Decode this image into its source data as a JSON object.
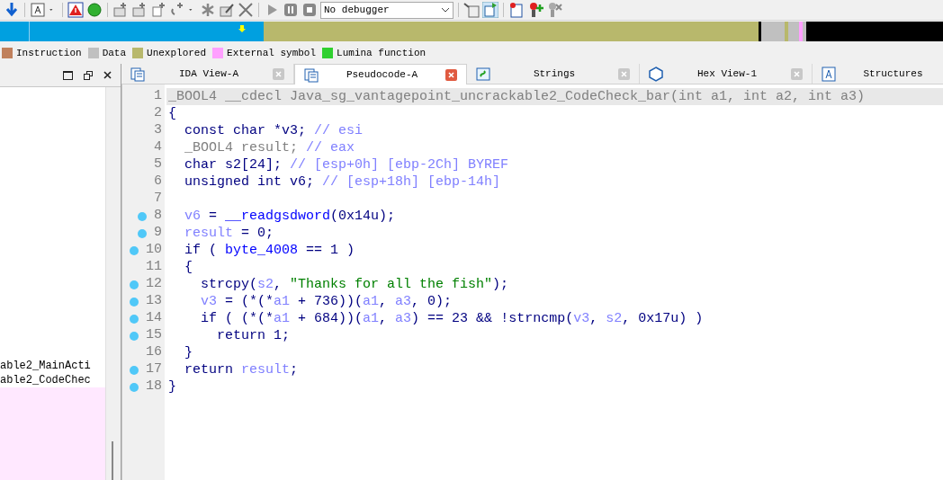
{
  "toolbar": {
    "debugger_select": {
      "value": "No debugger"
    }
  },
  "legend": [
    {
      "label": "Instruction",
      "color": "#c0805c"
    },
    {
      "label": "Data",
      "color": "#c0c0c0"
    },
    {
      "label": "Unexplored",
      "color": "#b8b86c"
    },
    {
      "label": "External symbol",
      "color": "#ffa0ff"
    },
    {
      "label": "Lumina function",
      "color": "#30d030"
    }
  ],
  "left_panel": {
    "items": [
      {
        "label": "able2_MainActi"
      },
      {
        "label": "able2_CodeChec"
      }
    ]
  },
  "tabs": [
    {
      "label": "IDA View-A",
      "selected": false,
      "closable": true
    },
    {
      "label": "Pseudocode-A",
      "selected": true,
      "closable": true
    },
    {
      "label": "Strings",
      "selected": false,
      "closable": true
    },
    {
      "label": "Hex View-1",
      "selected": false,
      "closable": true
    },
    {
      "label": "Structures",
      "selected": false,
      "closable": false
    }
  ],
  "code_lines": [
    {
      "number": "1",
      "breakpoint": false,
      "highlighted": true,
      "tokens": [
        {
          "kind": "dim",
          "text": "_BOOL4 __cdecl Java_sg_vantagepoint_uncrackable2_CodeCheck_bar(int a1, int a2, int a3)"
        }
      ]
    },
    {
      "number": "2",
      "breakpoint": false,
      "highlighted": false,
      "tokens": [
        {
          "kind": "plain",
          "text": "{"
        }
      ]
    },
    {
      "number": "3",
      "breakpoint": false,
      "highlighted": false,
      "tokens": [
        {
          "kind": "plain",
          "text": "  const char *v3; "
        },
        {
          "kind": "comment",
          "text": "// esi"
        }
      ]
    },
    {
      "number": "4",
      "breakpoint": false,
      "highlighted": false,
      "tokens": [
        {
          "kind": "dim",
          "text": "  _BOOL4 result; "
        },
        {
          "kind": "comment",
          "text": "// eax"
        }
      ]
    },
    {
      "number": "5",
      "breakpoint": false,
      "highlighted": false,
      "tokens": [
        {
          "kind": "plain",
          "text": "  char s2[24]; "
        },
        {
          "kind": "comment",
          "text": "// [esp+0h] [ebp-2Ch] BYREF"
        }
      ]
    },
    {
      "number": "6",
      "breakpoint": false,
      "highlighted": false,
      "tokens": [
        {
          "kind": "plain",
          "text": "  unsigned int v6; "
        },
        {
          "kind": "comment",
          "text": "// [esp+18h] [ebp-14h]"
        }
      ]
    },
    {
      "number": "7",
      "breakpoint": false,
      "highlighted": false
    },
    {
      "number": "8",
      "breakpoint": true,
      "highlighted": false,
      "tokens": [
        {
          "kind": "var",
          "text": "  v6"
        },
        {
          "kind": "plain",
          "text": " = "
        },
        {
          "kind": "global",
          "text": "__readgsdword"
        },
        {
          "kind": "plain",
          "text": "(0x14u);"
        }
      ]
    },
    {
      "number": "9",
      "breakpoint": true,
      "highlighted": false,
      "tokens": [
        {
          "kind": "var",
          "text": "  result"
        },
        {
          "kind": "plain",
          "text": " = 0;"
        }
      ]
    },
    {
      "number": "10",
      "breakpoint": true,
      "highlighted": false,
      "tokens": [
        {
          "kind": "plain",
          "text": "  if ( "
        },
        {
          "kind": "global",
          "text": "byte_4008"
        },
        {
          "kind": "plain",
          "text": " == 1 )"
        }
      ]
    },
    {
      "number": "11",
      "breakpoint": false,
      "highlighted": false,
      "tokens": [
        {
          "kind": "plain",
          "text": "  {"
        }
      ]
    },
    {
      "number": "12",
      "breakpoint": true,
      "highlighted": false,
      "tokens": [
        {
          "kind": "plain",
          "text": "    strcpy("
        },
        {
          "kind": "var",
          "text": "s2"
        },
        {
          "kind": "plain",
          "text": ", "
        },
        {
          "kind": "string",
          "text": "\"Thanks for all the fish\""
        },
        {
          "kind": "plain",
          "text": ");"
        }
      ]
    },
    {
      "number": "13",
      "breakpoint": true,
      "highlighted": false,
      "tokens": [
        {
          "kind": "var",
          "text": "    v3"
        },
        {
          "kind": "plain",
          "text": " = (*(*"
        },
        {
          "kind": "var",
          "text": "a1"
        },
        {
          "kind": "plain",
          "text": " + 736))("
        },
        {
          "kind": "var",
          "text": "a1"
        },
        {
          "kind": "plain",
          "text": ", "
        },
        {
          "kind": "var",
          "text": "a3"
        },
        {
          "kind": "plain",
          "text": ", 0);"
        }
      ]
    },
    {
      "number": "14",
      "breakpoint": true,
      "highlighted": false,
      "tokens": [
        {
          "kind": "plain",
          "text": "    if ( (*(*"
        },
        {
          "kind": "var",
          "text": "a1"
        },
        {
          "kind": "plain",
          "text": " + 684))("
        },
        {
          "kind": "var",
          "text": "a1"
        },
        {
          "kind": "plain",
          "text": ", "
        },
        {
          "kind": "var",
          "text": "a3"
        },
        {
          "kind": "plain",
          "text": ") == 23 && !strncmp("
        },
        {
          "kind": "var",
          "text": "v3"
        },
        {
          "kind": "plain",
          "text": ", "
        },
        {
          "kind": "var",
          "text": "s2"
        },
        {
          "kind": "plain",
          "text": ", 0x17u) )"
        }
      ]
    },
    {
      "number": "15",
      "breakpoint": true,
      "highlighted": false,
      "tokens": [
        {
          "kind": "plain",
          "text": "      return 1;"
        }
      ]
    },
    {
      "number": "16",
      "breakpoint": false,
      "highlighted": false,
      "tokens": [
        {
          "kind": "plain",
          "text": "  }"
        }
      ]
    },
    {
      "number": "17",
      "breakpoint": true,
      "highlighted": false,
      "tokens": [
        {
          "kind": "plain",
          "text": "  return "
        },
        {
          "kind": "var",
          "text": "result"
        },
        {
          "kind": "plain",
          "text": ";"
        }
      ]
    },
    {
      "number": "18",
      "breakpoint": true,
      "highlighted": false,
      "tokens": [
        {
          "kind": "plain",
          "text": "}"
        }
      ]
    }
  ]
}
